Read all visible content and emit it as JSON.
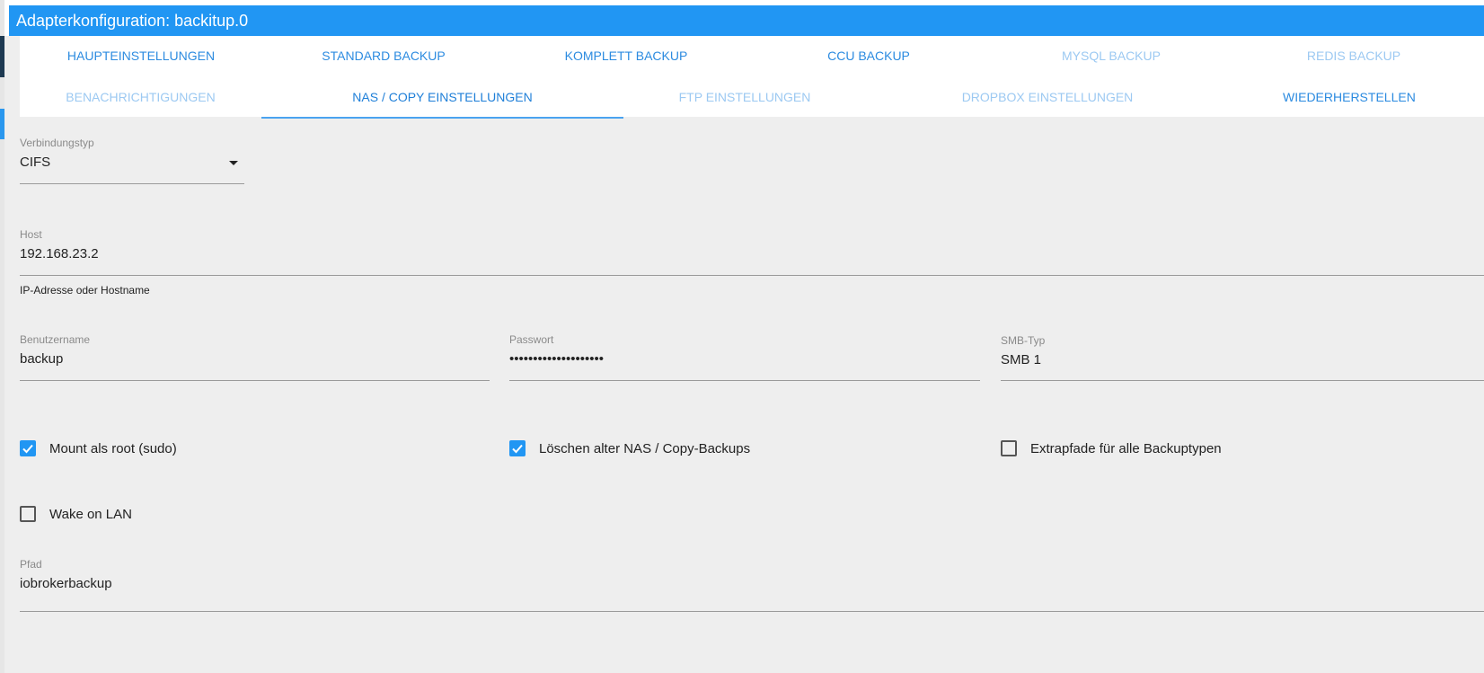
{
  "window": {
    "title": "Adapterkonfiguration: backitup.0"
  },
  "tabs": {
    "row1": [
      {
        "label": "HAUPTEINSTELLUNGEN"
      },
      {
        "label": "STANDARD BACKUP"
      },
      {
        "label": "KOMPLETT BACKUP"
      },
      {
        "label": "CCU BACKUP"
      },
      {
        "label": "MYSQL BACKUP"
      },
      {
        "label": "REDIS BACKUP"
      }
    ],
    "row2": [
      {
        "label": "BENACHRICHTIGUNGEN"
      },
      {
        "label": "NAS / COPY EINSTELLUNGEN"
      },
      {
        "label": "FTP EINSTELLUNGEN"
      },
      {
        "label": "DROPBOX EINSTELLUNGEN"
      },
      {
        "label": "WIEDERHERSTELLEN"
      }
    ],
    "active": "NAS / COPY EINSTELLUNGEN"
  },
  "form": {
    "connection_type": {
      "label": "Verbindungstyp",
      "value": "CIFS"
    },
    "host": {
      "label": "Host",
      "value": "192.168.23.2",
      "helper": "IP-Adresse oder Hostname"
    },
    "username": {
      "label": "Benutzername",
      "value": "backup"
    },
    "password": {
      "label": "Passwort",
      "value": "••••••••••••••••••••"
    },
    "smb_type": {
      "label": "SMB-Typ",
      "value": "SMB 1"
    },
    "mount_root": {
      "label": "Mount als root (sudo)",
      "checked": true
    },
    "delete_old": {
      "label": "Löschen alter NAS / Copy-Backups",
      "checked": true
    },
    "extra_paths": {
      "label": "Extrapfade für alle Backuptypen",
      "checked": false
    },
    "wake_on_lan": {
      "label": "Wake on LAN",
      "checked": false
    },
    "path": {
      "label": "Pfad",
      "value": "iobrokerbackup"
    }
  },
  "colors": {
    "accent": "#2196f3",
    "tab_active": "#1f7fd8",
    "tab_inactive_light": "#9cc9f2",
    "panel_bg": "#eeeeee"
  }
}
